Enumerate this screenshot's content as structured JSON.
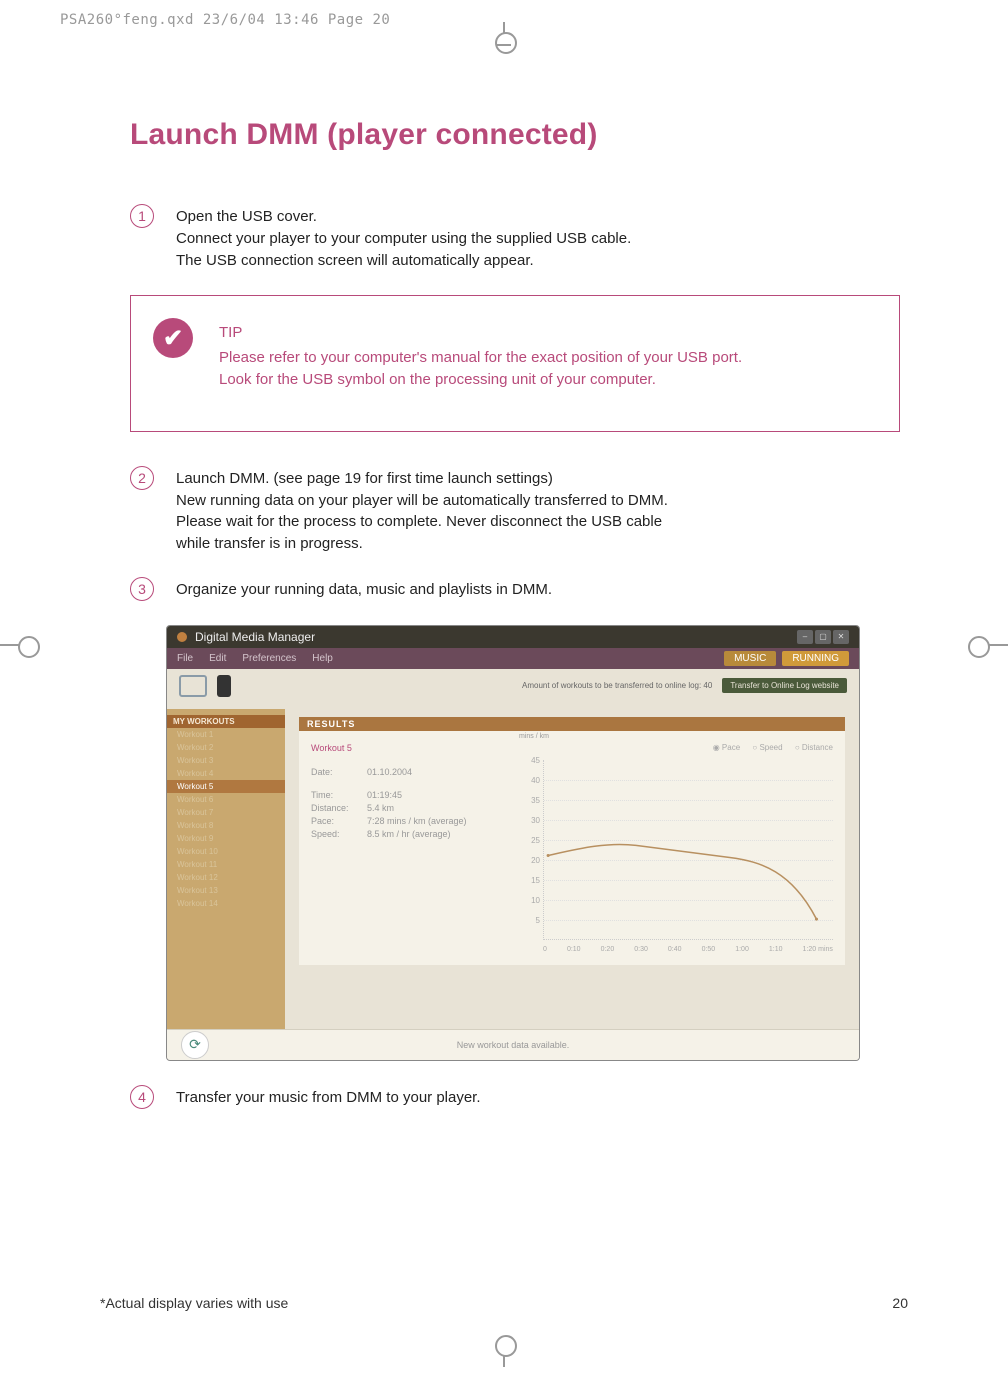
{
  "print_header": "PSA260°feng.qxd  23/6/04  13:46  Page 20",
  "title": "Launch DMM (player connected)",
  "steps": {
    "s1": {
      "num": "1",
      "lines": [
        "Open the USB cover.",
        "Connect your player to your computer using the supplied USB cable.",
        "The USB connection screen will automatically appear."
      ]
    },
    "s2": {
      "num": "2",
      "lines": [
        "Launch DMM.  (see page 19 for first time launch settings)",
        "New running data on your player will be automatically transferred to DMM.",
        "Please wait for the process to complete.  Never disconnect the USB cable",
        "while  transfer is in progress."
      ]
    },
    "s3": {
      "num": "3",
      "lines": [
        "Organize your running data, music and playlists in DMM."
      ]
    },
    "s4": {
      "num": "4",
      "lines": [
        "Transfer your music from DMM to your player."
      ]
    }
  },
  "tip": {
    "check": "✔",
    "label": "TIP",
    "text1": "Please refer to your computer's manual for the exact position of your USB port.",
    "text2": "Look for the USB symbol on the processing unit of your computer."
  },
  "dmm": {
    "window_title": "Digital Media Manager",
    "menu": {
      "file": "File",
      "edit": "Edit",
      "pref": "Preferences",
      "help": "Help"
    },
    "tabs": {
      "music": "MUSIC",
      "running": "RUNNING"
    },
    "transfer_info": "Amount of workouts to be transferred to online log:  40",
    "transfer_btn": "Transfer to Online Log website",
    "sidebar": {
      "header": "MY WORKOUTS",
      "items": [
        "Workout 1",
        "Workout 2",
        "Workout 3",
        "Workout 4",
        "Workout 5",
        "Workout 6",
        "Workout 7",
        "Workout 8",
        "Workout 9",
        "Workout 10",
        "Workout 11",
        "Workout 12",
        "Workout 13",
        "Workout 14"
      ]
    },
    "results": {
      "header": "RESULTS",
      "workout": "Workout 5",
      "details": {
        "date_l": "Date:",
        "date_v": "01.10.2004",
        "time_l": "Time:",
        "time_v": "01:19:45",
        "dist_l": "Distance:",
        "dist_v": "5.4 km",
        "pace_l": "Pace:",
        "pace_v": "7:28 mins / km (average)",
        "speed_l": "Speed:",
        "speed_v": "8.5 km / hr (average)"
      },
      "radios": {
        "pace": "Pace",
        "speed": "Speed",
        "distance": "Distance"
      },
      "yaxis_label": "mins / km"
    },
    "footer": "New workout data available."
  },
  "chart_data": {
    "type": "line",
    "ylabel": "mins / km",
    "xlabel": "mins",
    "yticks": [
      45,
      40,
      35,
      30,
      25,
      20,
      15,
      10,
      5,
      0
    ],
    "xticks": [
      "0",
      "0:10",
      "0:20",
      "0:30",
      "0:40",
      "0:50",
      "1:00",
      "1:10",
      "1:20"
    ],
    "series": [
      {
        "name": "Pace",
        "approx_curve": [
          [
            0,
            21
          ],
          [
            0.12,
            22
          ],
          [
            0.25,
            24
          ],
          [
            0.38,
            23
          ],
          [
            0.5,
            22
          ],
          [
            0.62,
            21
          ],
          [
            0.75,
            20
          ],
          [
            0.88,
            18
          ],
          [
            1.0,
            6
          ]
        ]
      }
    ],
    "ylim": [
      0,
      45
    ]
  },
  "footer": {
    "note": "*Actual display varies with use",
    "page": "20"
  }
}
